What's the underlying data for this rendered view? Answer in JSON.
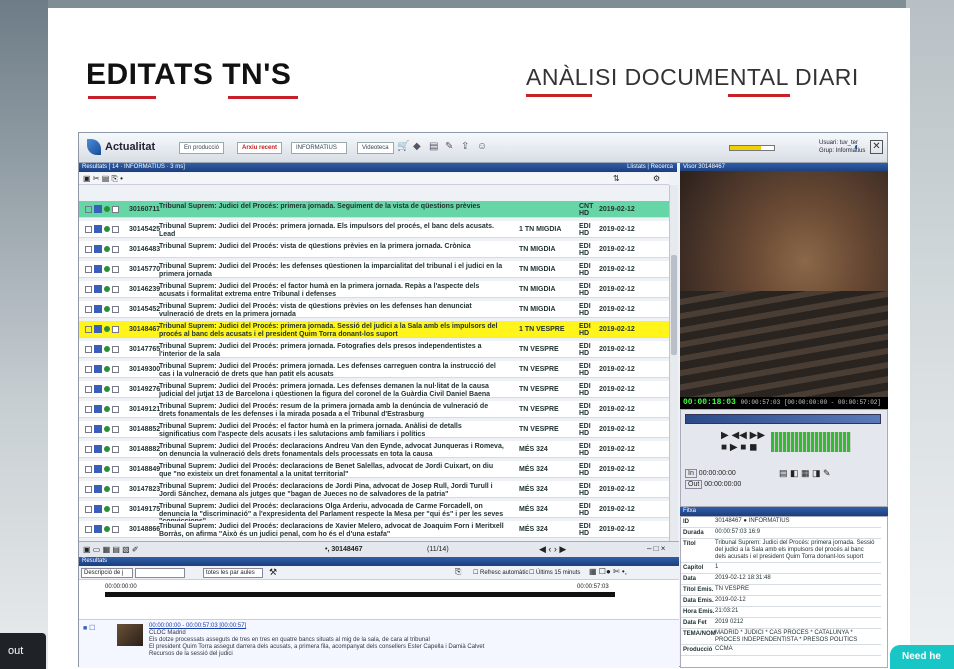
{
  "slide": {
    "title_left": "EDITATS TN'S",
    "title_right_pre": "ANÀLISI DOCUMENTAL ",
    "title_right_ul": "DIARI"
  },
  "app": {
    "brand": "Actualitat",
    "btn_produccio": "En producció",
    "btn_recent": "Arxiu recent",
    "btn_informatius": "INFORMATIUS",
    "btn_videoteca": "Videoteca",
    "user_line1": "Usuari: tuv_ter",
    "user_line2": "Grup: Informatius",
    "progress": 0.7,
    "results_header": "Resultats [ 14 · INFORMATIUS · 3 ms]",
    "results_right": "Llistats | Recerca",
    "viewer_header": "Visor 30148467"
  },
  "rows": [
    {
      "id": "30160711",
      "text": "Tribunal Suprem: Judici del Procés: primera jornada. Seguiment de la vista de qüestions prèvies",
      "prog": "",
      "type": "CNT HD",
      "date": "2019-02-12",
      "style": "sel-g"
    },
    {
      "id": "30145425",
      "text": "Tribunal Suprem: Judici del Procés: primera jornada. Els impulsors del procés, el banc dels acusats. Lead",
      "prog": "1 TN MIGDIA",
      "type": "EDI HD",
      "date": "2019-02-12",
      "style": ""
    },
    {
      "id": "30146483",
      "text": "Tribunal Suprem: Judici del Procés: vista de qüestions prèvies en la primera jornada. Crònica",
      "prog": "TN MIGDIA",
      "type": "EDI HD",
      "date": "2019-02-12",
      "style": ""
    },
    {
      "id": "30145770",
      "text": "Tribunal Suprem: Judici del Procés: les defenses qüestionen la imparcialitat del tribunal i el judici en la primera jornada",
      "prog": "TN MIGDIA",
      "type": "EDI HD",
      "date": "2019-02-12",
      "style": ""
    },
    {
      "id": "30146239",
      "text": "Tribunal Suprem: Judici del Procés: el factor humà en la primera jornada. Repàs a l'aspecte dels acusats i formalitat extrema entre Tribunal i defenses",
      "prog": "TN MIGDIA",
      "type": "EDI HD",
      "date": "2019-02-12",
      "style": ""
    },
    {
      "id": "30145452",
      "text": "Tribunal Suprem: Judici del Procés: vista de qüestions prèvies on les defenses han denunciat vulneració de drets en la primera jornada",
      "prog": "TN MIGDIA",
      "type": "EDI HD",
      "date": "2019-02-12",
      "style": ""
    },
    {
      "id": "30148467",
      "text": "Tribunal Suprem: Judici del Procés: primera jornada. Sessió del judici a la Sala amb els impulsors del procés al banc dels acusats i el president Quim Torra donant-los suport",
      "prog": "1 TN VESPRE",
      "type": "EDI HD",
      "date": "2019-02-12",
      "style": "sel-y"
    },
    {
      "id": "30147765",
      "text": "Tribunal Suprem: Judici del Procés: primera jornada. Fotografies dels presos independentistes a l'interior de la sala",
      "prog": "TN VESPRE",
      "type": "EDI HD",
      "date": "2019-02-12",
      "style": ""
    },
    {
      "id": "30149300",
      "text": "Tribunal Suprem: Judici del Procés: primera jornada. Les defenses carreguen contra la instrucció del cas i la vulneració de drets que han patit els acusats",
      "prog": "TN VESPRE",
      "type": "EDI HD",
      "date": "2019-02-12",
      "style": ""
    },
    {
      "id": "30149276",
      "text": "Tribunal Suprem: Judici del Procés: primera jornada. Les defenses demanen la nul·litat de la causa judicial del jutjat 13 de Barcelona i qüestionen la figura del coronel de la Guàrdia Civil Daniel Baena",
      "prog": "TN VESPRE",
      "type": "EDI HD",
      "date": "2019-02-12",
      "style": ""
    },
    {
      "id": "30149121",
      "text": "Tribunal Suprem: Judici del Procés: resum de la primera jornada amb la denúncia de vulneració de drets fonamentals de les defenses i la mirada posada a el Tribunal d'Estrasburg",
      "prog": "TN VESPRE",
      "type": "EDI HD",
      "date": "2019-02-12",
      "style": ""
    },
    {
      "id": "30148852",
      "text": "Tribunal Suprem: Judici del Procés: el factor humà en la primera jornada. Anàlisi de detalls significatius com l'aspecte dels acusats i les salutacions amb familiars i polítics",
      "prog": "TN VESPRE",
      "type": "EDI HD",
      "date": "2019-02-12",
      "style": ""
    },
    {
      "id": "30148882",
      "text": "Tribunal Suprem: Judici del Procés: declaracions Andreu Van den Eynde, advocat Junqueras i Romeva, on denuncia la vulneració dels drets fonamentals dels processats en tota la causa",
      "prog": "MÉS 324",
      "type": "EDI HD",
      "date": "2019-02-12",
      "style": ""
    },
    {
      "id": "30148849",
      "text": "Tribunal Suprem: Judici del Procés: declaracions de Benet Salellas, advocat de Jordi Cuixart, on diu que \"no existeix un dret fonamental a la unitat territorial\"",
      "prog": "MÉS 324",
      "type": "EDI HD",
      "date": "2019-02-12",
      "style": ""
    },
    {
      "id": "30147823",
      "text": "Tribunal Suprem: Judici del Procés: declaracions de Jordi Pina, advocat de Josep Rull, Jordi Turull i Jordi Sánchez, demana als jutges que \"bagan de Jueces no de salvadores de la patria\"",
      "prog": "MÉS 324",
      "type": "EDI HD",
      "date": "2019-02-12",
      "style": ""
    },
    {
      "id": "30149175",
      "text": "Tribunal Suprem: Judici del Procés: declaracions Olga Arderiu, advocada de Carme Forcadell, on denuncia la \"discriminació\" a l'expresidenta del Parlament respecte la Mesa per \"qui és\" i per les seves \"conviccions\"",
      "prog": "MÉS 324",
      "type": "EDI HD",
      "date": "2019-02-12",
      "style": ""
    },
    {
      "id": "30148866",
      "text": "Tribunal Suprem: Judici del Procés: declaracions de Xavier Melero, advocat de Joaquim Forn i Meritxell Borràs, on afirma \"Això és un judici penal, com ho és el d'una estafa\"",
      "prog": "MÉS 324",
      "type": "EDI HD",
      "date": "2019-02-12",
      "style": ""
    }
  ],
  "nav": {
    "id": "30148467",
    "count": "(11/14)"
  },
  "timecode": {
    "main": "00:00:18:03",
    "sub": "00:00:57:03 [00:00:00:00 - 00:00:57:02]",
    "in": "00:00:00:00",
    "out": "00:00:00:00",
    "in_label": "In",
    "out_label": "Out"
  },
  "fitxa": {
    "header": "Fitxa",
    "rows": [
      {
        "l": "ID",
        "v": "30148467   ●                      INFORMATIUS"
      },
      {
        "l": "Durada",
        "v": "00:00:57:03                          16:9"
      },
      {
        "l": "Títol",
        "v": "Tribunal Suprem: Judici del Procés: primera jornada. Sessió del judici a la Sala amb els impulsors del procés al banc dels acusats i el president Quim Torra donant-los suport"
      },
      {
        "l": "Capítol",
        "v": "1"
      },
      {
        "l": "Data",
        "v": "2019-02-12 18:31:48"
      },
      {
        "l": "Títol Emis.",
        "v": "TN VESPRE"
      },
      {
        "l": "Data Emis.",
        "v": "2019-02-12"
      },
      {
        "l": "Hora Emis.",
        "v": "21:03:21"
      },
      {
        "l": "Data Fet",
        "v": "2019 0212"
      },
      {
        "l": "TEMA/NOM",
        "v": "MADRID * JUDICI * CAS PROCES * CATALUNYA * PROCES INDEPENDENTISTA * PRESOS POLITICS"
      },
      {
        "l": "Producció",
        "v": "CCMA"
      }
    ]
  },
  "results_panel": {
    "header": "Resultats",
    "sel1": "Descripció de j",
    "sel2": "totes les par aules",
    "refresc": "Refresc automàtic",
    "ultims": "Últims 15 minuts",
    "tc_start": "00:00:00:00",
    "tc_end": "00:00:57:03",
    "clip_tc": "00:00:00:00 - 00:00:57:03  [00:00:57]",
    "clip_line1": "CLOC Madrid",
    "clip_line2": "Els dotze processats asseguts de tres en tres en quatre bancs situats al mig de la sala, de cara al tribunal",
    "clip_line3": "El president Quim Torra assegut darrera dels acusats, a primera fila, acompanyat dels consellers Ester Capella i Damià Calvet",
    "clip_line4": "Recursos de la sessió del judici"
  },
  "corner": {
    "left": "out",
    "right": "Need he"
  }
}
